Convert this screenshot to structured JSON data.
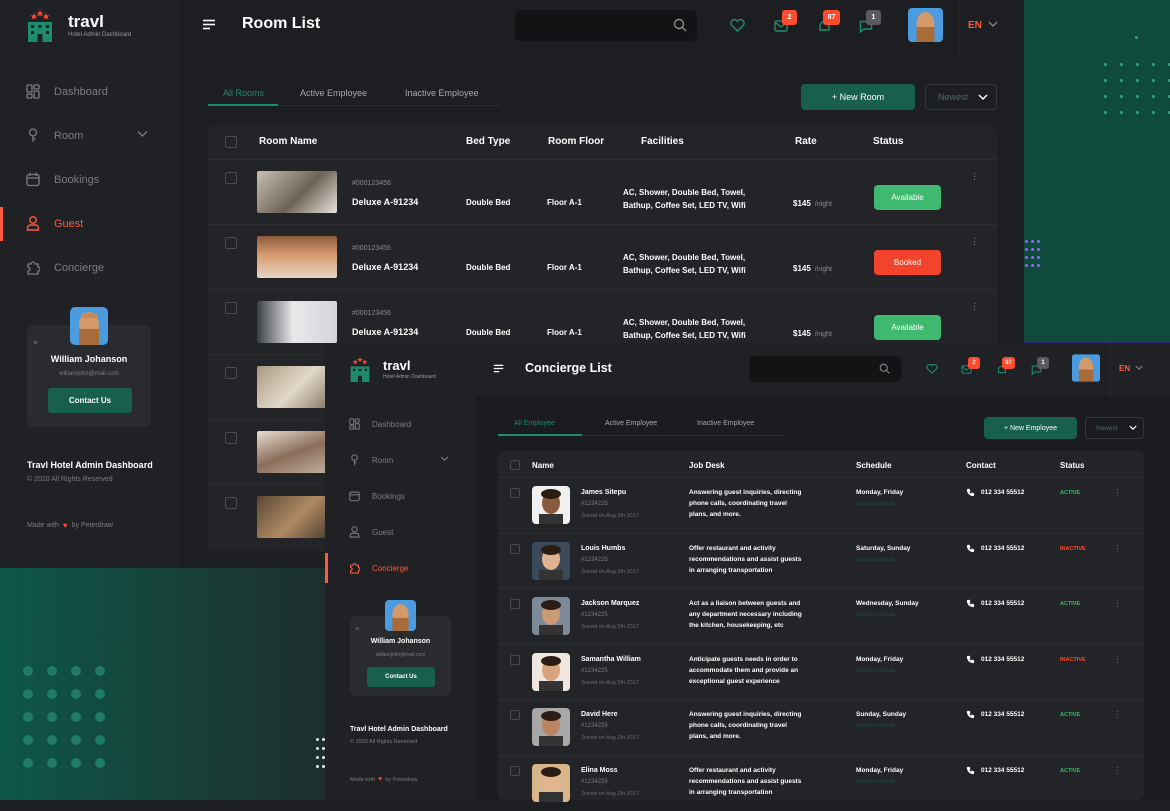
{
  "colors": {
    "accent": "#ff5a3c",
    "green": "#185f4e",
    "available": "#3fb96f",
    "booked": "#f2442c",
    "active": "#3fb96f",
    "inactive": "#ff4b2e"
  },
  "app": {
    "brand": "travl",
    "brand_sub": "Hotel Admin Dashboard"
  },
  "panel1": {
    "title": "Room List",
    "lang": "EN",
    "badges": {
      "mail": "2",
      "bell": "87",
      "chat": "1"
    },
    "nav": [
      {
        "label": "Dashboard",
        "icon": "dashboard-icon"
      },
      {
        "label": "Room",
        "icon": "key-icon"
      },
      {
        "label": "Bookings",
        "icon": "calendar-icon"
      },
      {
        "label": "Guest",
        "icon": "user-icon"
      },
      {
        "label": "Concierge",
        "icon": "puzzle-icon"
      }
    ],
    "profile": {
      "name": "William Johanson",
      "email": "williamjohn@mail.com",
      "button": "Contact Us"
    },
    "footer": {
      "title": "Travl Hotel Admin Dashboard",
      "copyright": "© 2020 All Rights Reserved",
      "made_with": "Made with",
      "by": "by Peterdraw"
    },
    "tabs": [
      "All Rooms",
      "Active Employee",
      "Inactive Employee"
    ],
    "new_button": "+ New Room",
    "sort": "Newest",
    "columns": [
      "Room Name",
      "Bed Type",
      "Room Floor",
      "Facilities",
      "Rate",
      "Status"
    ],
    "rooms": [
      {
        "id": "#000123456",
        "name": "Deluxe A-91234",
        "bed": "Double Bed",
        "floor": "Floor A-1",
        "fac1": "AC, Shower, Double Bed, Towel,",
        "fac2": "Bathup, Coffee Set, LED TV, Wifi",
        "rate": "$145",
        "per": "/night",
        "status": "Available"
      },
      {
        "id": "#000123456",
        "name": "Deluxe A-91234",
        "bed": "Double Bed",
        "floor": "Floor A-1",
        "fac1": "AC, Shower, Double Bed, Towel,",
        "fac2": "Bathup, Coffee Set, LED TV, Wifi",
        "rate": "$145",
        "per": "/night",
        "status": "Booked"
      },
      {
        "id": "#000123456",
        "name": "Deluxe A-91234",
        "bed": "Double Bed",
        "floor": "Floor A-1",
        "fac1": "AC, Shower, Double Bed, Towel,",
        "fac2": "Bathup, Coffee Set, LED TV, Wifi",
        "rate": "$145",
        "per": "/night",
        "status": "Available"
      }
    ]
  },
  "panel2": {
    "title": "Concierge List",
    "lang": "EN",
    "badges": {
      "mail": "2",
      "bell": "87",
      "chat": "1"
    },
    "nav": [
      {
        "label": "Dashboard"
      },
      {
        "label": "Room"
      },
      {
        "label": "Bookings"
      },
      {
        "label": "Guest"
      },
      {
        "label": "Concierge"
      }
    ],
    "profile": {
      "name": "William Johanson",
      "email": "williamjohn@mail.com",
      "button": "Contact Us"
    },
    "footer": {
      "title": "Travl Hotel Admin Dashboard",
      "copyright": "© 2020 All Rights Reserved",
      "made_with": "Made with",
      "by": "by Peterdraw"
    },
    "tabs": [
      "All Employee",
      "Active Employee",
      "Inactive Employee"
    ],
    "new_button": "+ New Employee",
    "sort": "Newest",
    "columns": [
      "Name",
      "Job Desk",
      "Schedule",
      "Contact",
      "Status"
    ],
    "employees": [
      {
        "name": "James Sitepu",
        "id": "#1234225",
        "joined": "Joined on Aug 2th 2017",
        "job1": "Answering guest inquiries, directing",
        "job2": "phone calls, coordinating travel",
        "job3": "plans, and more.",
        "schedule": "Monday, Friday",
        "sched_sub": "Check schedule",
        "phone": "012 334 55512",
        "status": "ACTIVE"
      },
      {
        "name": "Louis Humbs",
        "id": "#1234225",
        "joined": "Joined on Aug 2th 2017",
        "job1": "Offer restaurant and activity",
        "job2": "recommendations and assist guests",
        "job3": "in arranging transportation",
        "schedule": "Saturday, Sunday",
        "sched_sub": "Check schedule",
        "phone": "012 334 55512",
        "status": "INACTIVE"
      },
      {
        "name": "Jackson Marquez",
        "id": "#1234225",
        "joined": "Joined on Aug 2th 2017",
        "job1": "Act as a liaison between guests and",
        "job2": "any department necessary including",
        "job3": "the kitchen, housekeeping, etc",
        "schedule": "Wednesday, Sunday",
        "sched_sub": "Check schedule",
        "phone": "012 334 55512",
        "status": "ACTIVE"
      },
      {
        "name": "Samantha William",
        "id": "#1234225",
        "joined": "Joined on Aug 2th 2017",
        "job1": "Anticipate guests needs in order to",
        "job2": "accommodate them and provide an",
        "job3": "exceptional guest experience",
        "schedule": "Monday, Friday",
        "sched_sub": "Check schedule",
        "phone": "012 334 55512",
        "status": "INACTIVE"
      },
      {
        "name": "David Here",
        "id": "#1234225",
        "joined": "Joined on Aug 2th 2017",
        "job1": "Answering guest inquiries, directing",
        "job2": "phone calls, coordinating travel",
        "job3": "plans, and more.",
        "schedule": "Sunday, Sunday",
        "sched_sub": "Check schedule",
        "phone": "012 334 55512",
        "status": "ACTIVE"
      },
      {
        "name": "Elina Moss",
        "id": "#1234225",
        "joined": "Joined on Aug 2th 2017",
        "job1": "Offer restaurant and activity",
        "job2": "recommendations and assist guests",
        "job3": "in arranging transportation",
        "schedule": "Monday, Friday",
        "sched_sub": "Check schedule",
        "phone": "012 334 55512",
        "status": "ACTIVE"
      }
    ]
  }
}
